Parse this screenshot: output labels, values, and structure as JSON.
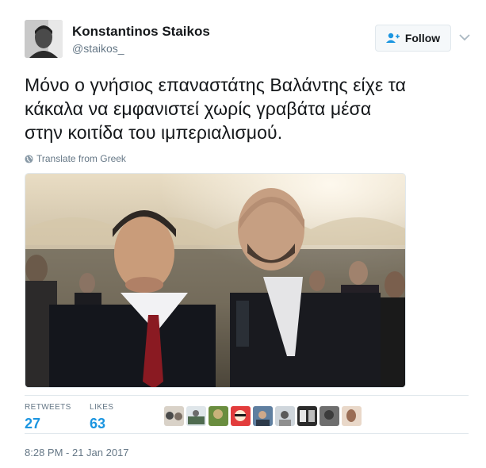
{
  "user": {
    "name": "Konstantinos Staikos",
    "handle": "@staikos_"
  },
  "follow_button": {
    "label": "Follow"
  },
  "tweet": {
    "lines": [
      "Μόνο ο γνήσιος επαναστάτης Βαλάντης είχε τα",
      "κάκαλα να εμφανιστεί χωρίς γραβάτα μέσα",
      "στην κοιτίδα του ιμπεριαλισμού."
    ]
  },
  "translate": {
    "label": "Translate from Greek",
    "icon": "globe-icon"
  },
  "stats": {
    "retweets_label": "RETWEETS",
    "retweets": "27",
    "likes_label": "LIKES",
    "likes": "63"
  },
  "likers_count": 9,
  "timestamp": "8:28 PM - 21 Jan 2017",
  "colors": {
    "text": "#14171a",
    "secondary": "#657786",
    "accent": "#1b95e0",
    "border": "#e1e8ed"
  }
}
